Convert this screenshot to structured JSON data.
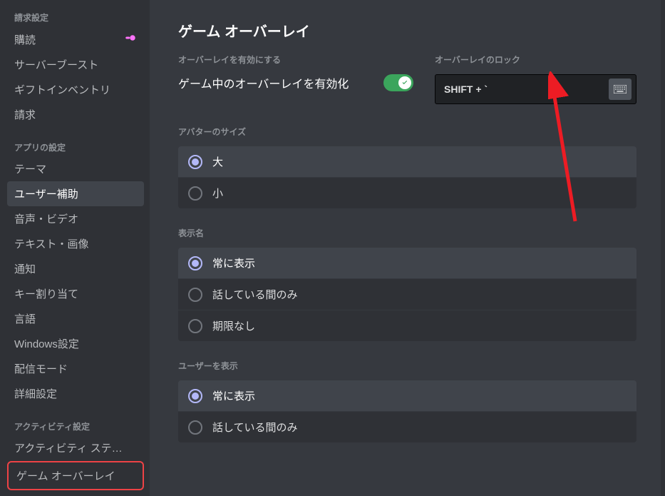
{
  "sidebar": {
    "billing": {
      "header": "請求設定",
      "items": [
        {
          "label": "購読",
          "icon": "nitro"
        },
        {
          "label": "サーバーブースト"
        },
        {
          "label": "ギフトインベントリ"
        },
        {
          "label": "請求"
        }
      ]
    },
    "app": {
      "header": "アプリの設定",
      "items": [
        {
          "label": "テーマ"
        },
        {
          "label": "ユーザー補助",
          "selected": true
        },
        {
          "label": "音声・ビデオ"
        },
        {
          "label": "テキスト・画像"
        },
        {
          "label": "通知"
        },
        {
          "label": "キー割り当て"
        },
        {
          "label": "言語"
        },
        {
          "label": "Windows設定"
        },
        {
          "label": "配信モード"
        },
        {
          "label": "詳細設定"
        }
      ]
    },
    "activity": {
      "header": "アクティビティ設定",
      "items": [
        {
          "label": "アクティビティ ステ…"
        },
        {
          "label": "ゲーム オーバーレイ",
          "highlighted": true
        }
      ]
    }
  },
  "page": {
    "title": "ゲーム オーバーレイ",
    "enable": {
      "header": "オーバーレイを有効にする",
      "label": "ゲーム中のオーバーレイを有効化",
      "on": true
    },
    "lock": {
      "header": "オーバーレイのロック",
      "keybind": "SHIFT + `"
    },
    "avatar": {
      "header": "アバターのサイズ",
      "options": [
        {
          "label": "大",
          "selected": true
        },
        {
          "label": "小"
        }
      ]
    },
    "displayName": {
      "header": "表示名",
      "options": [
        {
          "label": "常に表示",
          "selected": true
        },
        {
          "label": "話している間のみ"
        },
        {
          "label": "期限なし"
        }
      ]
    },
    "showUsers": {
      "header": "ユーザーを表示",
      "options": [
        {
          "label": "常に表示",
          "selected": true
        },
        {
          "label": "話している間のみ"
        }
      ]
    }
  }
}
